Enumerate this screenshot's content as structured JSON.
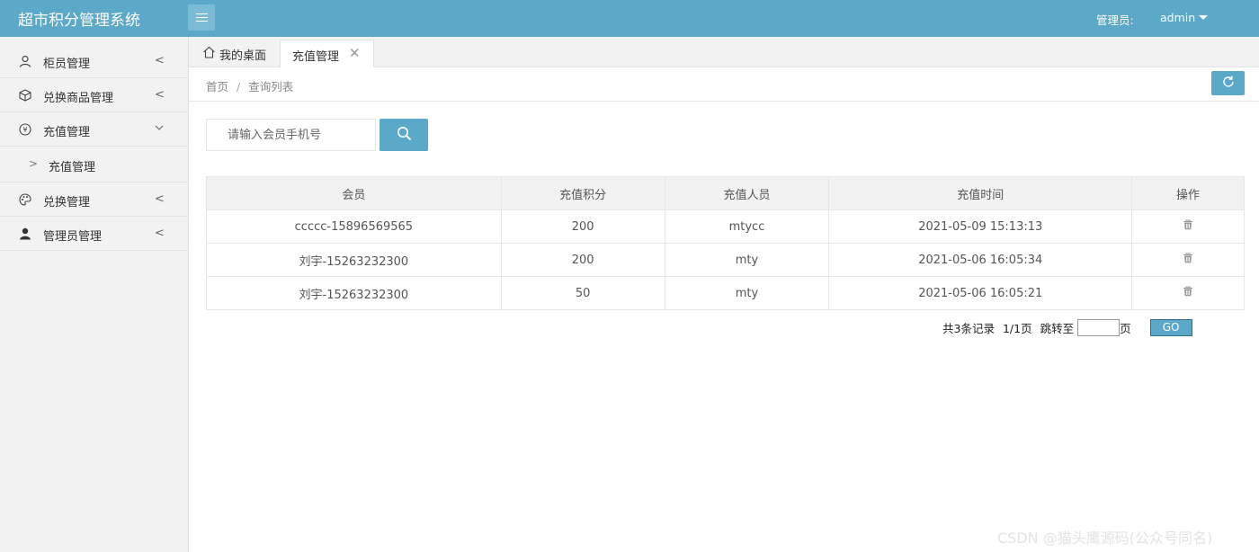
{
  "app": {
    "title": "超市积分管理系统"
  },
  "header": {
    "admin_label": "管理员:",
    "admin_user": "admin"
  },
  "sidebar": {
    "items": [
      {
        "label": "柜员管理",
        "icon": "user-icon"
      },
      {
        "label": "兑换商品管理",
        "icon": "cube-icon"
      },
      {
        "label": "充值管理",
        "icon": "yen-icon",
        "expanded": true,
        "children": [
          {
            "label": "充值管理"
          }
        ]
      },
      {
        "label": "兑换管理",
        "icon": "palette-icon"
      },
      {
        "label": "管理员管理",
        "icon": "person-icon"
      }
    ]
  },
  "tabs": [
    {
      "label": "我的桌面",
      "icon": "home-icon"
    },
    {
      "label": "充值管理",
      "active": true,
      "close": "✕"
    }
  ],
  "breadcrumb": {
    "home": "首页",
    "sep": "/",
    "current": "查询列表"
  },
  "search": {
    "placeholder": "请输入会员手机号"
  },
  "table": {
    "headers": [
      "会员",
      "充值积分",
      "充值人员",
      "充值时间",
      "操作"
    ],
    "rows": [
      {
        "member": "ccccc-15896569565",
        "points": "200",
        "operator": "mtycc",
        "time": "2021-05-09 15:13:13"
      },
      {
        "member": "刘宇-15263232300",
        "points": "200",
        "operator": "mty",
        "time": "2021-05-06 16:05:34"
      },
      {
        "member": "刘宇-15263232300",
        "points": "50",
        "operator": "mty",
        "time": "2021-05-06 16:05:21"
      }
    ]
  },
  "pager": {
    "total": "共3条记录",
    "pages": "1/1页",
    "jump": "跳转至",
    "page_unit": "页",
    "go": "GO"
  },
  "watermark": "CSDN @猫头鹰源码(公众号同名)",
  "colors": {
    "accent": "#5ba8c8",
    "sidebar_bg": "#f2f2f2"
  }
}
